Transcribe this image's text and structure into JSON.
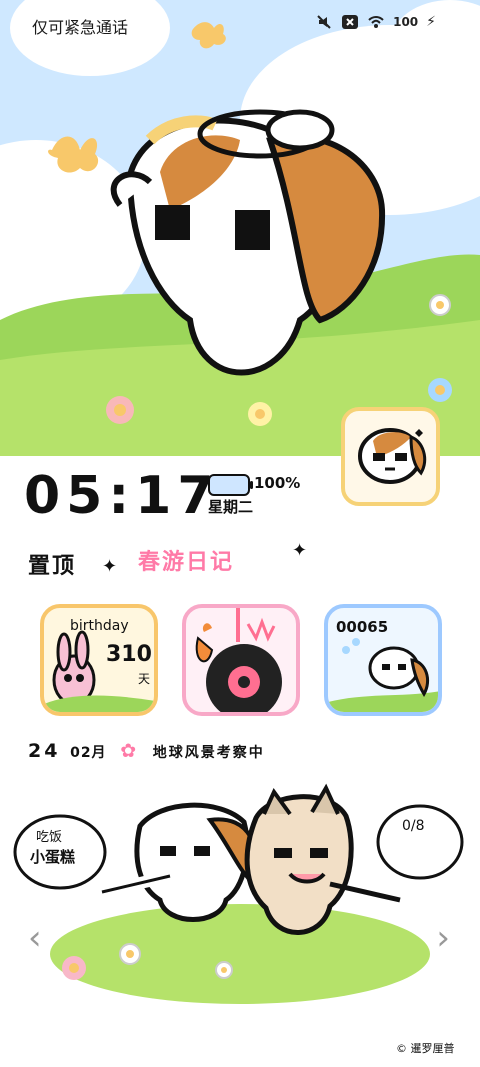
{
  "status": {
    "carrier": "仅可紧急通话",
    "battery": "100",
    "icons": [
      "mute-icon",
      "x-icon",
      "wifi-icon",
      "battery-icon",
      "charging-icon"
    ]
  },
  "lock": {
    "time": "05:17",
    "battery_percent": "100%",
    "weekday": "星期二"
  },
  "sections": {
    "pinned": "置顶",
    "spring_diary": "春游日记"
  },
  "cards": {
    "birthday": {
      "title": "birthday",
      "days": "310",
      "unit": "天"
    },
    "steps": {
      "count": "00065"
    }
  },
  "date_line": {
    "day": "24",
    "month": "02月",
    "mission": "地球风景考察中"
  },
  "scene": {
    "bubble_left": "吃饭",
    "bubble_left_sub": "小蛋糕",
    "bubble_right": "0/8"
  },
  "copyright": "© 暹罗厘普",
  "colors": {
    "sky": "#cfe8ff",
    "grass": "#9cd65a",
    "accent_pink": "#ff7aa7",
    "accent_yellow": "#f6d277",
    "accent_blue": "#9dc9ff"
  }
}
